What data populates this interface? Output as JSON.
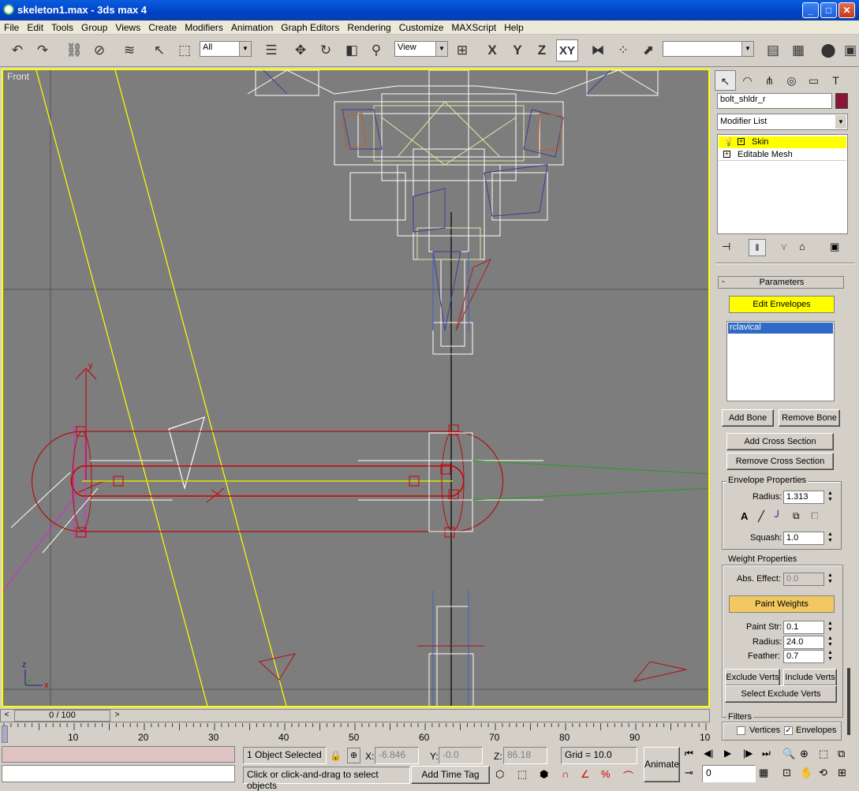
{
  "window": {
    "title": "skeleton1.max - 3ds max 4",
    "minimize": "_",
    "maximize": "□",
    "close": "✕"
  },
  "menu": [
    "File",
    "Edit",
    "Tools",
    "Group",
    "Views",
    "Create",
    "Modifiers",
    "Animation",
    "Graph Editors",
    "Rendering",
    "Customize",
    "MAXScript",
    "Help"
  ],
  "toolbar": {
    "selection_filter": "All",
    "ref_coord": "View",
    "axis_x": "X",
    "axis_y": "Y",
    "axis_z": "Z",
    "axis_xy": "XY",
    "named_selection": ""
  },
  "viewport": {
    "label": "Front",
    "axis_z": "z",
    "axis_x": "x",
    "gizmo_y": "y"
  },
  "command_panel": {
    "object_name": "bolt_shldr_r",
    "object_color": "#8b1538",
    "modifier_list": "Modifier List",
    "stack": [
      "Skin",
      "Editable Mesh"
    ],
    "rollout_title": "Parameters",
    "rollout_sign": "-",
    "edit_envelopes": "Edit Envelopes",
    "bones": [
      "rclavical"
    ],
    "add_bone": "Add Bone",
    "remove_bone": "Remove Bone",
    "add_cross_section": "Add Cross Section",
    "remove_cross_section": "Remove Cross Section",
    "envelope_properties": {
      "label": "Envelope Properties",
      "radius_label": "Radius:",
      "radius": "1.313",
      "squash_label": "Squash:",
      "squash": "1.0"
    },
    "weight_properties": {
      "label": "Weight Properties",
      "abs_effect_label": "Abs. Effect:",
      "abs_effect": "0.0",
      "paint_weights": "Paint Weights",
      "paint_str_label": "Paint Str:",
      "paint_str": "0.1",
      "radius_label": "Radius:",
      "radius": "24.0",
      "feather_label": "Feather:",
      "feather": "0.7"
    },
    "exclude_verts": "Exclude Verts",
    "include_verts": "Include Verts",
    "select_exclude_verts": "Select Exclude Verts",
    "filters": {
      "label": "Filters",
      "vertices": "Vertices",
      "vertices_checked": false,
      "envelopes": "Envelopes",
      "envelopes_checked": true
    }
  },
  "timeline": {
    "frame": "0 / 100",
    "ticks": [
      "10",
      "20",
      "30",
      "40",
      "50",
      "60",
      "70",
      "80",
      "90",
      "10"
    ]
  },
  "status": {
    "selection": "1 Object Selected",
    "x_label": "X:",
    "x": "-6.846",
    "y_label": "Y:",
    "y": "-0.0",
    "z_label": "Z:",
    "z": "86.18",
    "grid": "Grid = 10.0",
    "prompt": "Click or click-and-drag to select objects",
    "add_time_tag": "Add Time Tag",
    "animate": "Animate",
    "current_frame": "0"
  }
}
